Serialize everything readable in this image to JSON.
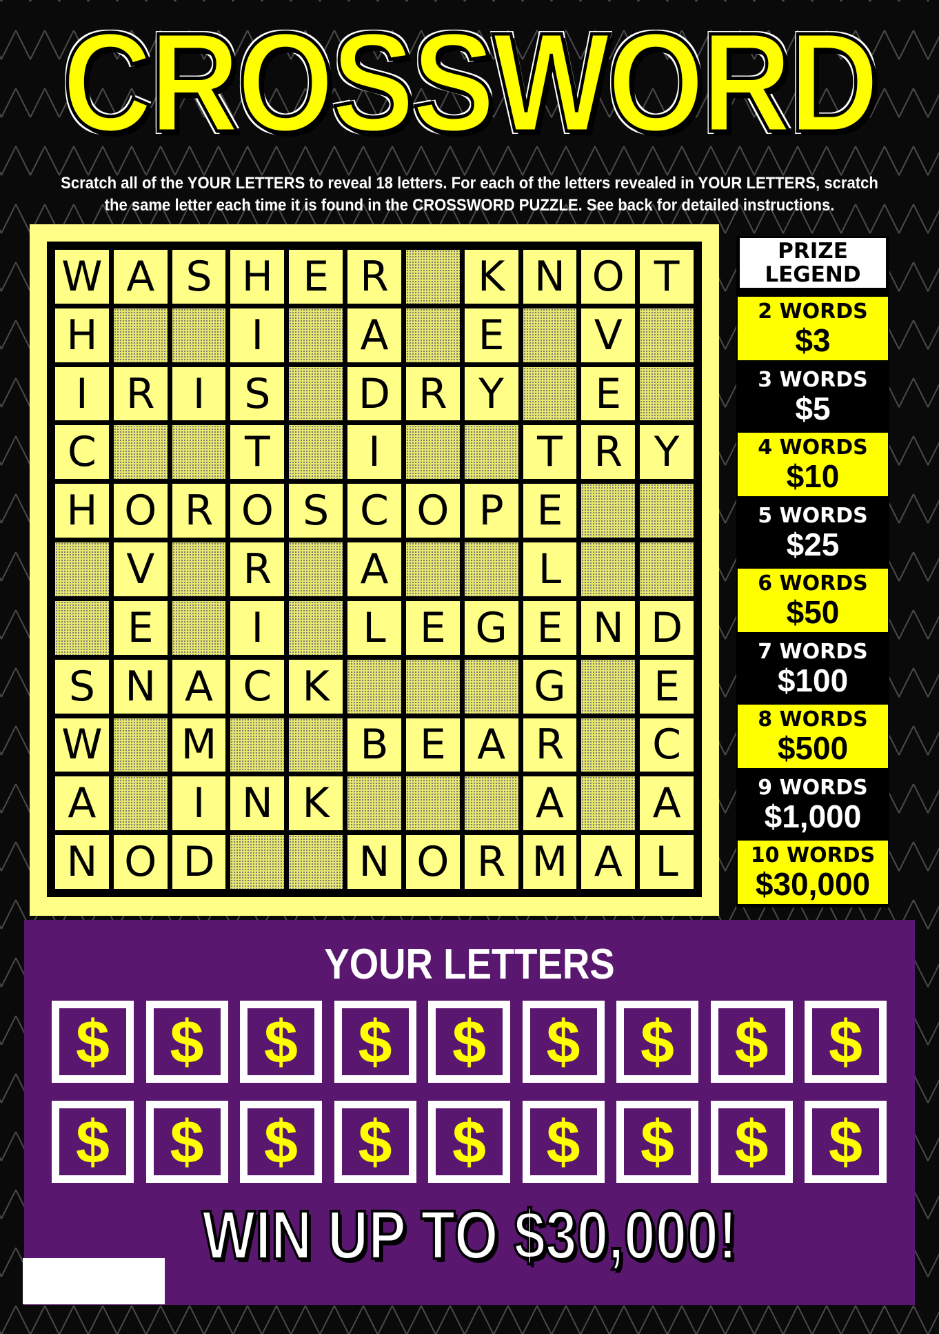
{
  "title": "CROSSWORD",
  "instructions": "Scratch all of the YOUR LETTERS to reveal 18 letters. For each of the letters revealed in YOUR LETTERS, scratch the same letter each time it is found in the CROSSWORD PUZZLE. See back for detailed instructions.",
  "grid": [
    "WASHER KNOT",
    "H  I A E V ",
    "IRIS DRY E ",
    "C  T I  TRY",
    "HOROSCOPE  ",
    " V R A  L  ",
    " E I LEGEND",
    "SNACK   G E",
    "W M  BEAR C",
    "A INK   A A",
    "NOD  NORMAL"
  ],
  "prize_legend": {
    "header": [
      "PRIZE",
      "LEGEND"
    ],
    "rows": [
      {
        "words": "2 WORDS",
        "amount": "$3",
        "style": "yellow"
      },
      {
        "words": "3 WORDS",
        "amount": "$5",
        "style": "black"
      },
      {
        "words": "4 WORDS",
        "amount": "$10",
        "style": "yellow"
      },
      {
        "words": "5 WORDS",
        "amount": "$25",
        "style": "black"
      },
      {
        "words": "6 WORDS",
        "amount": "$50",
        "style": "yellow"
      },
      {
        "words": "7 WORDS",
        "amount": "$100",
        "style": "black"
      },
      {
        "words": "8 WORDS",
        "amount": "$500",
        "style": "yellow"
      },
      {
        "words": "9 WORDS",
        "amount": "$1,000",
        "style": "black"
      },
      {
        "words": "10 WORDS",
        "amount": "$30,000",
        "style": "yellow"
      }
    ]
  },
  "your_letters": {
    "title": "YOUR LETTERS",
    "spots": [
      "$",
      "$",
      "$",
      "$",
      "$",
      "$",
      "$",
      "$",
      "$",
      "$",
      "$",
      "$",
      "$",
      "$",
      "$",
      "$",
      "$",
      "$"
    ]
  },
  "footer": "WIN UP TO $30,000!",
  "colors": {
    "title_yellow": "#ffff00",
    "panel_yellow": "#ffff88",
    "purple": "#5a176f",
    "background": "#0a0a0a"
  }
}
